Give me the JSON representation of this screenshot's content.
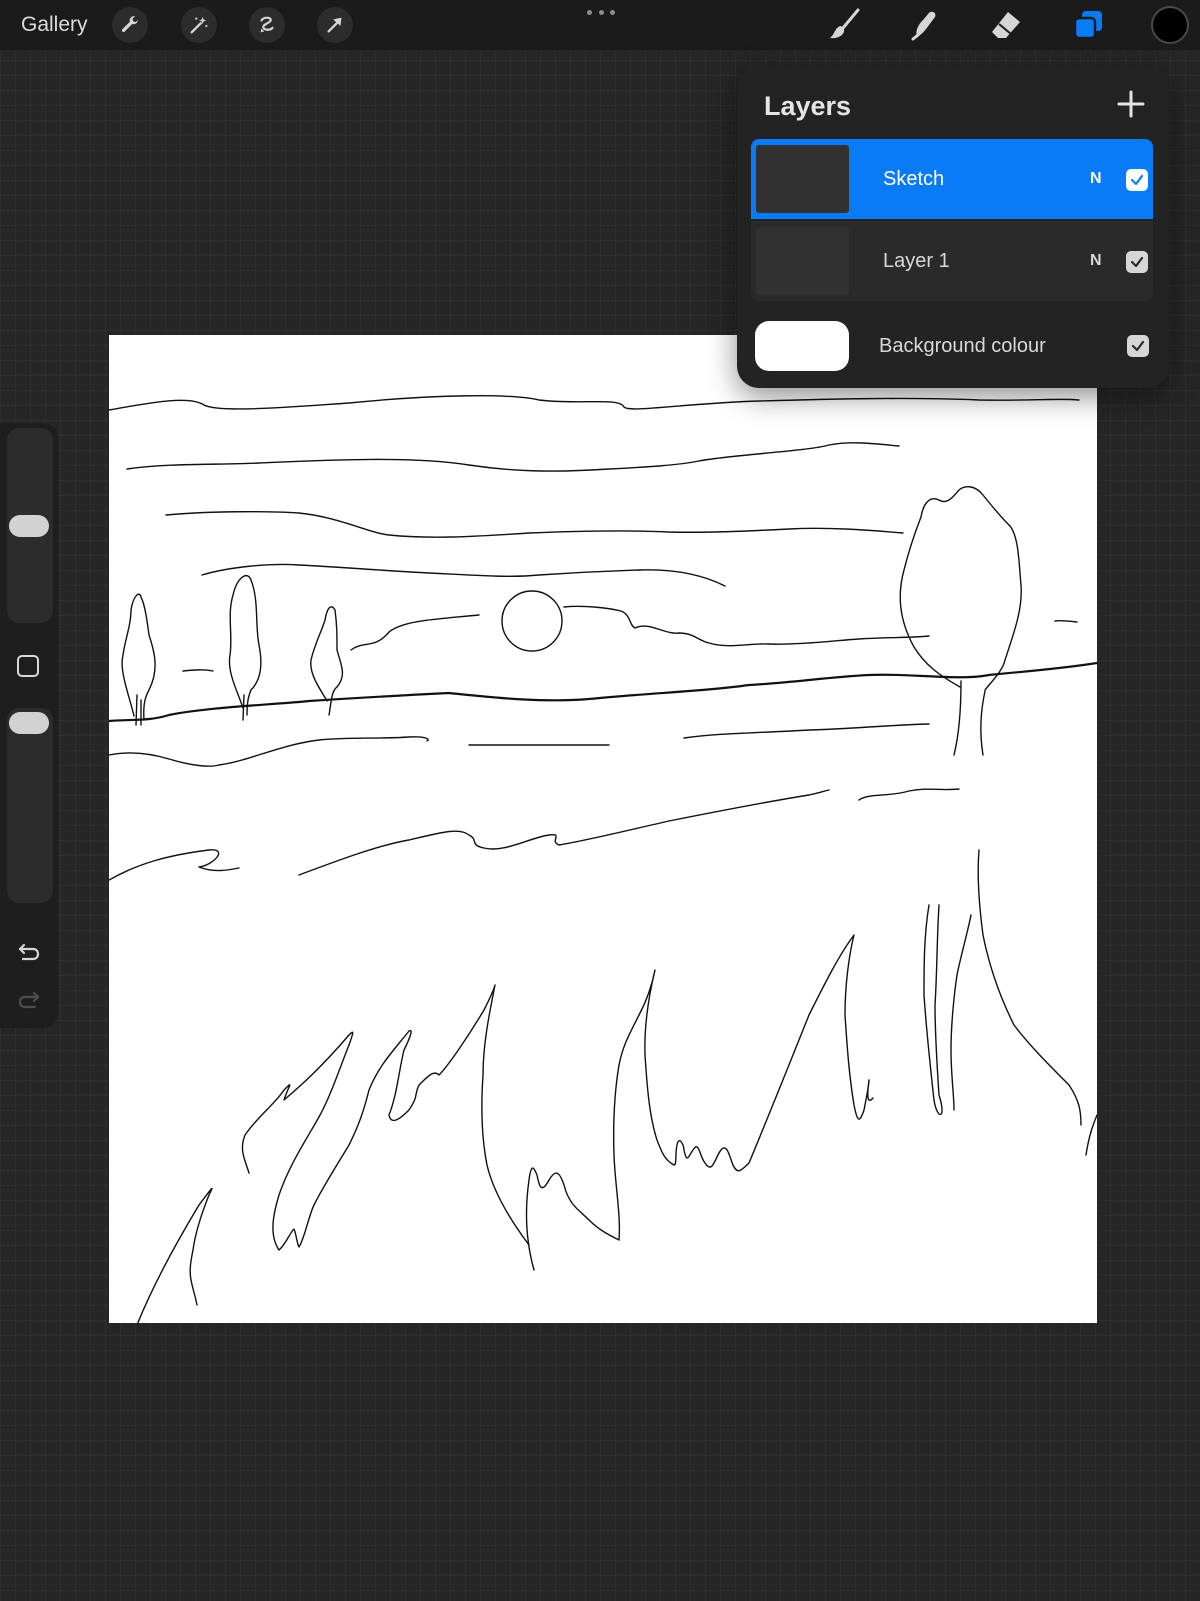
{
  "toolbar": {
    "gallery_label": "Gallery",
    "left_tools": [
      {
        "icon": "wrench-icon"
      },
      {
        "icon": "magic-wand-icon"
      },
      {
        "icon": "selection-icon"
      },
      {
        "icon": "transform-arrow-icon"
      }
    ],
    "right_tools": [
      {
        "icon": "brush-icon"
      },
      {
        "icon": "smudge-icon"
      },
      {
        "icon": "eraser-icon"
      },
      {
        "icon": "layers-icon",
        "active": true
      }
    ],
    "current_color": "#000000",
    "accent_color": "#0a7bf6"
  },
  "sidebar": {
    "brush_size_level": 0.5,
    "opacity_level": 1.0,
    "undo_icon": "undo-icon",
    "redo_icon": "redo-icon"
  },
  "layers_panel": {
    "title": "Layers",
    "add_icon": "plus-icon",
    "layers": [
      {
        "name": "Sketch",
        "blend_mode": "N",
        "visible": true,
        "selected": true
      },
      {
        "name": "Layer 1",
        "blend_mode": "N",
        "visible": true,
        "selected": false
      }
    ],
    "background": {
      "label": "Background colour",
      "color": "#ffffff",
      "visible": true
    }
  },
  "canvas": {
    "background_color": "#ffffff",
    "stroke_color": "#000000"
  }
}
